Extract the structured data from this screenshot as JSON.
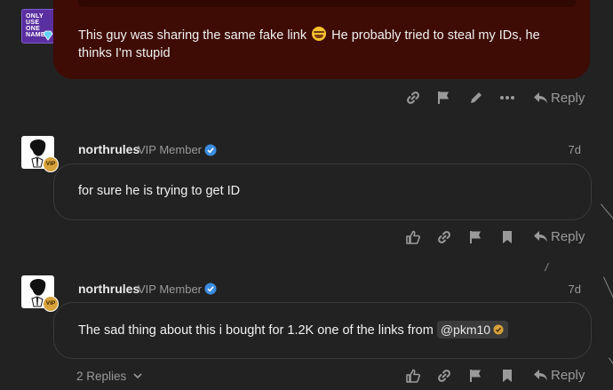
{
  "posts": [
    {
      "avatar_text": "ONLY USE ONE NAME",
      "avatar_badge": "gem-badge",
      "text_before_emoji": "This guy was sharing the same fake link ",
      "emoji": "joy-emoji",
      "text_after_emoji": " He probably tried to steal my IDs, he thinks I'm stupid",
      "actions": {
        "reply": "Reply"
      }
    },
    {
      "username": "northrules",
      "role": "VIP Member",
      "time": "7d",
      "avatar_badge": "VIP",
      "text": "for sure he is trying to get ID",
      "actions": {
        "reply": "Reply"
      }
    },
    {
      "username": "northrules",
      "role": "VIP Member",
      "time": "7d",
      "avatar_badge": "VIP",
      "text": "The sad thing about this i bought for 1.2K one of the links from ",
      "mention": "@pkm10",
      "replies_label": "2 Replies",
      "actions": {
        "reply": "Reply"
      }
    }
  ],
  "colors": {
    "background": "#222222",
    "highlight_bubble": "#3f0b05",
    "bubble_border": "#3b3b3b",
    "verified": "#3b8de0",
    "vip_badge": "#d7a23a",
    "muted": "#9a9a9a"
  },
  "icons": [
    "link-icon",
    "flag-icon",
    "edit-icon",
    "more-icon",
    "reply-icon",
    "like-icon",
    "bookmark-icon",
    "verified-icon",
    "chevron-down-icon"
  ]
}
